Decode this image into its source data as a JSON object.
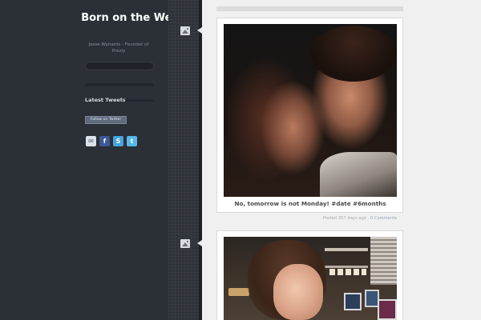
{
  "sidebar": {
    "title": "Born on the Web",
    "description": "Jesse Wynants - Founder of Prezly",
    "latest_tweets_label": "Latest Tweets",
    "follow_label": "Follow on Twitter",
    "social_icons": [
      "mail-icon",
      "facebook-icon",
      "skype-icon",
      "twitter-icon"
    ]
  },
  "posts": [
    {
      "type_icon": "photo-icon",
      "caption": "No, tomorrow is not Monday! #date #6months",
      "posted": "Posted 357 days ago",
      "separator": "·",
      "comments": "0 Comments"
    },
    {
      "type_icon": "photo-icon"
    }
  ],
  "colors": {
    "sidebar_bg": "#2b2f36",
    "main_bg": "#f0f0f0",
    "card_bg": "#ffffff",
    "link": "#8ea4bf"
  }
}
